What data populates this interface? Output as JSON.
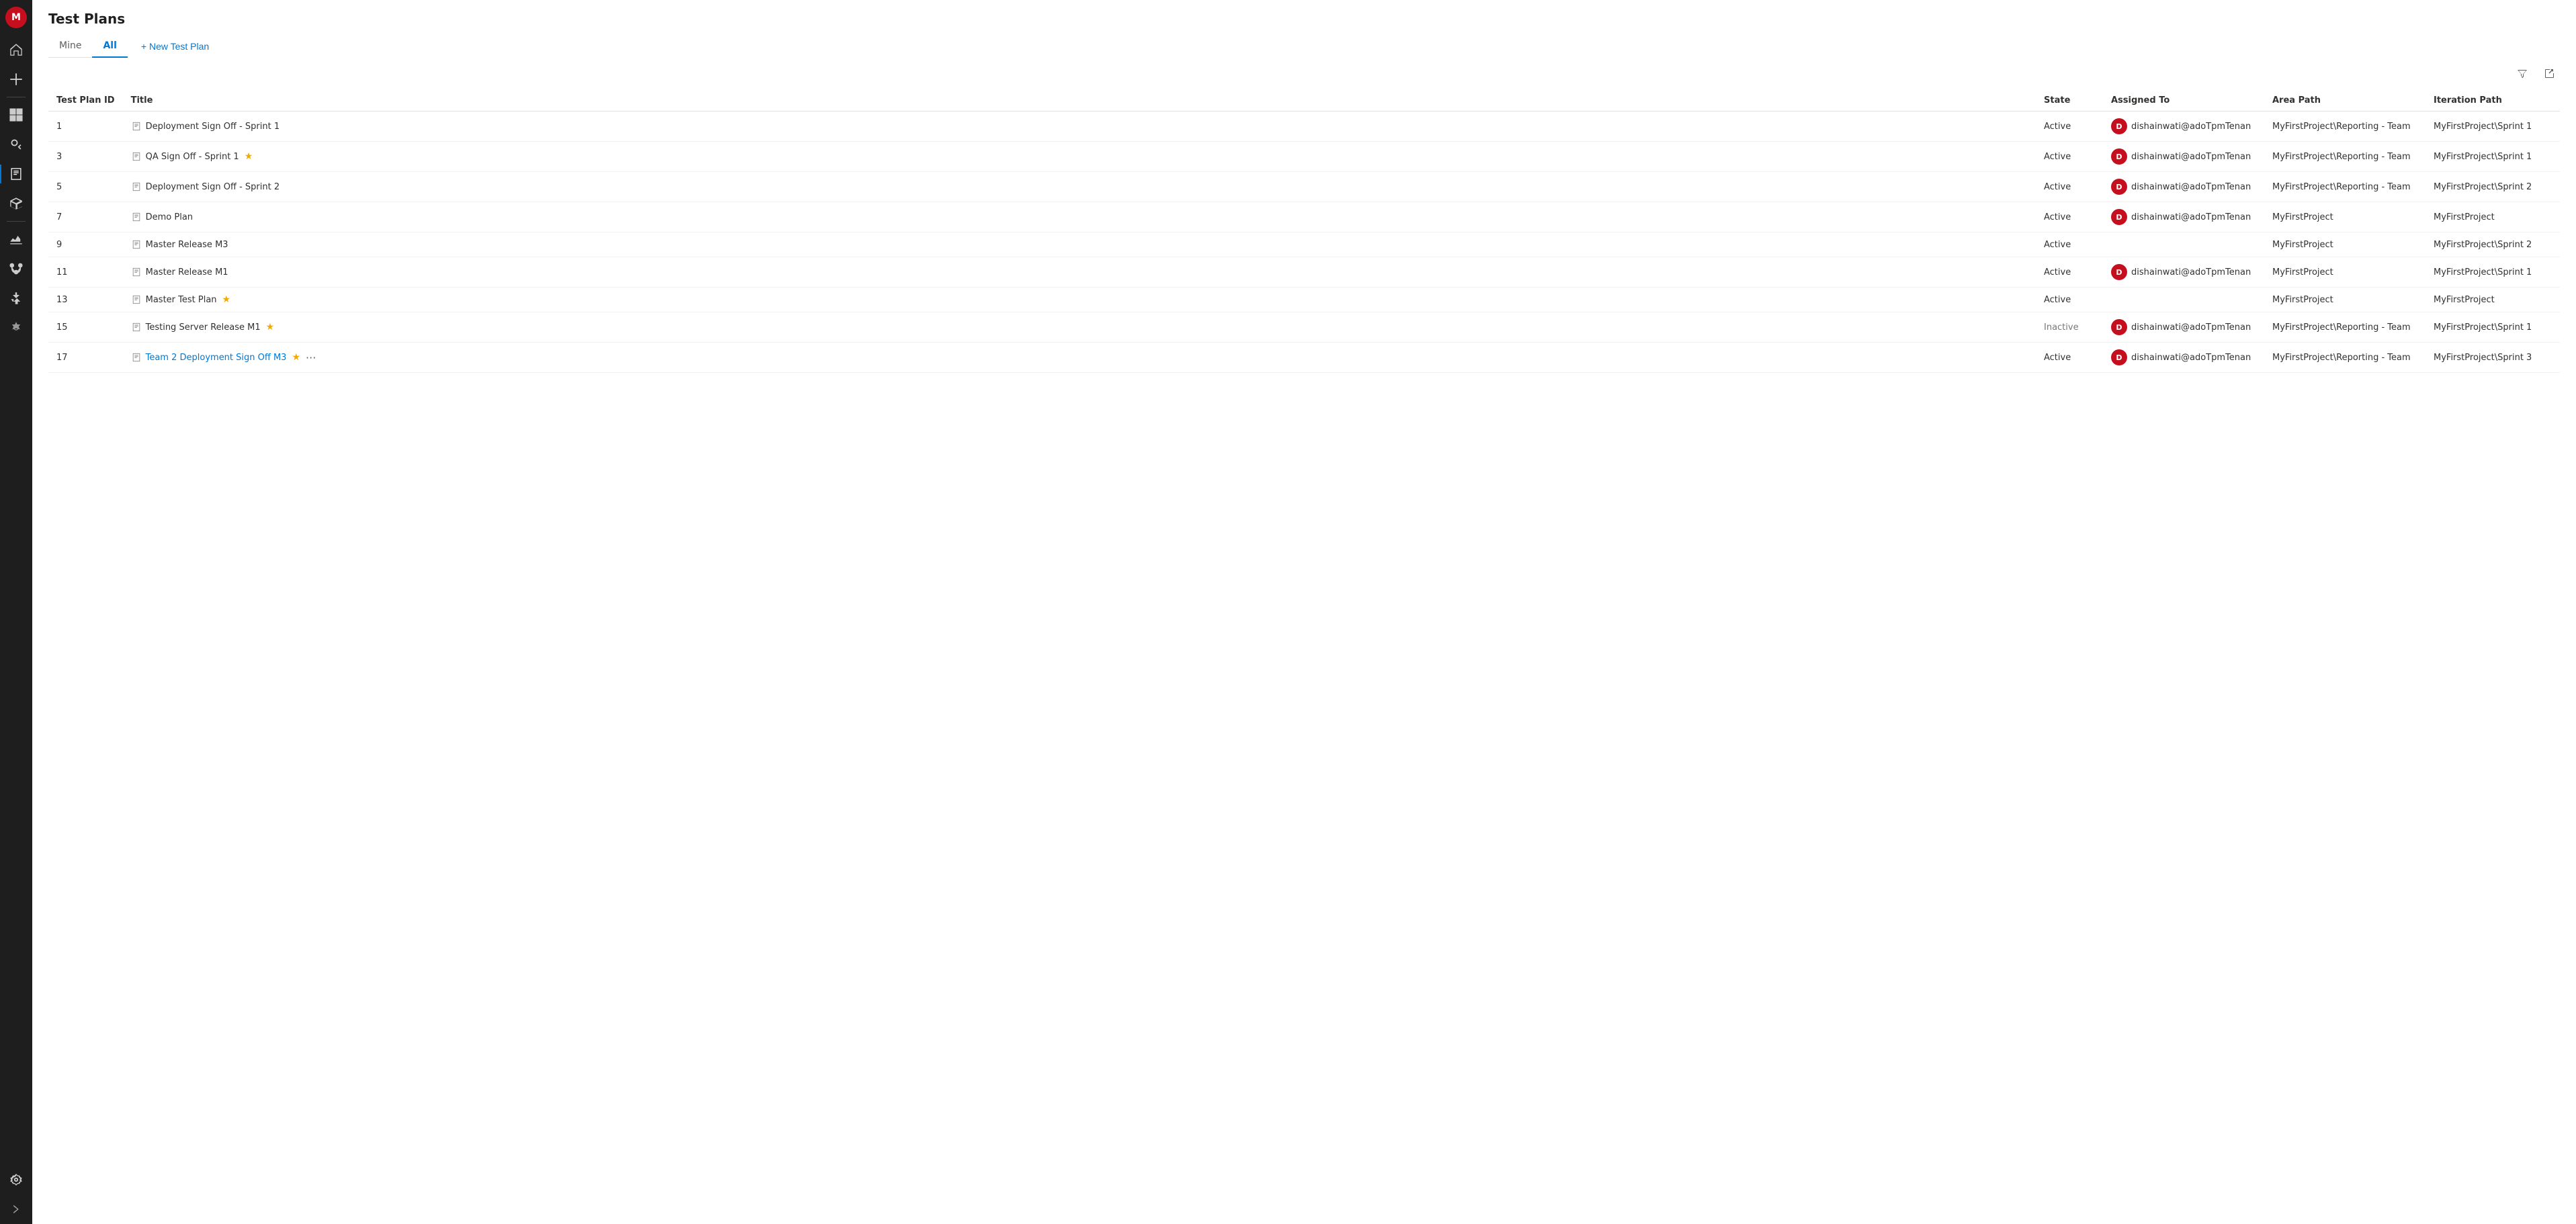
{
  "app": {
    "avatar_label": "M",
    "avatar_color": "#c50f1f"
  },
  "page": {
    "title": "Test Plans"
  },
  "tabs": {
    "mine": "Mine",
    "all": "All",
    "new_plan": "+ New Test Plan"
  },
  "toolbar": {
    "filter_icon": "filter",
    "open_icon": "open"
  },
  "table": {
    "columns": {
      "id": "Test Plan ID",
      "title": "Title",
      "state": "State",
      "assigned_to": "Assigned To",
      "area_path": "Area Path",
      "iteration_path": "Iteration Path"
    },
    "rows": [
      {
        "id": "1",
        "title": "Deployment Sign Off - Sprint 1",
        "is_link": false,
        "starred": false,
        "state": "Active",
        "assigned_to": "dishainwati@adoTpmTenan",
        "has_avatar": true,
        "area_path": "MyFirstProject\\Reporting - Team",
        "iteration_path": "MyFirstProject\\Sprint 1"
      },
      {
        "id": "3",
        "title": "QA Sign Off - Sprint 1",
        "is_link": false,
        "starred": true,
        "state": "Active",
        "assigned_to": "dishainwati@adoTpmTenan",
        "has_avatar": true,
        "area_path": "MyFirstProject\\Reporting - Team",
        "iteration_path": "MyFirstProject\\Sprint 1"
      },
      {
        "id": "5",
        "title": "Deployment Sign Off - Sprint 2",
        "is_link": false,
        "starred": false,
        "state": "Active",
        "assigned_to": "dishainwati@adoTpmTenan",
        "has_avatar": true,
        "area_path": "MyFirstProject\\Reporting - Team",
        "iteration_path": "MyFirstProject\\Sprint 2"
      },
      {
        "id": "7",
        "title": "Demo Plan",
        "is_link": false,
        "starred": false,
        "state": "Active",
        "assigned_to": "dishainwati@adoTpmTenan",
        "has_avatar": true,
        "area_path": "MyFirstProject",
        "iteration_path": "MyFirstProject"
      },
      {
        "id": "9",
        "title": "Master Release M3",
        "is_link": false,
        "starred": false,
        "state": "Active",
        "assigned_to": "",
        "has_avatar": false,
        "area_path": "MyFirstProject",
        "iteration_path": "MyFirstProject\\Sprint 2"
      },
      {
        "id": "11",
        "title": "Master Release M1",
        "is_link": false,
        "starred": false,
        "state": "Active",
        "assigned_to": "dishainwati@adoTpmTenan",
        "has_avatar": true,
        "area_path": "MyFirstProject",
        "iteration_path": "MyFirstProject\\Sprint 1"
      },
      {
        "id": "13",
        "title": "Master Test Plan",
        "is_link": false,
        "starred": true,
        "state": "Active",
        "assigned_to": "",
        "has_avatar": false,
        "area_path": "MyFirstProject",
        "iteration_path": "MyFirstProject"
      },
      {
        "id": "15",
        "title": "Testing Server Release M1",
        "is_link": false,
        "starred": true,
        "state": "Inactive",
        "assigned_to": "dishainwati@adoTpmTenan",
        "has_avatar": true,
        "area_path": "MyFirstProject\\Reporting - Team",
        "iteration_path": "MyFirstProject\\Sprint 1"
      },
      {
        "id": "17",
        "title": "Team 2 Deployment Sign Off M3",
        "is_link": true,
        "starred": true,
        "state": "Active",
        "assigned_to": "dishainwati@adoTpmTenan",
        "has_avatar": true,
        "area_path": "MyFirstProject\\Reporting - Team",
        "iteration_path": "MyFirstProject\\Sprint 3"
      }
    ]
  },
  "nav": {
    "expand_label": "<<"
  }
}
